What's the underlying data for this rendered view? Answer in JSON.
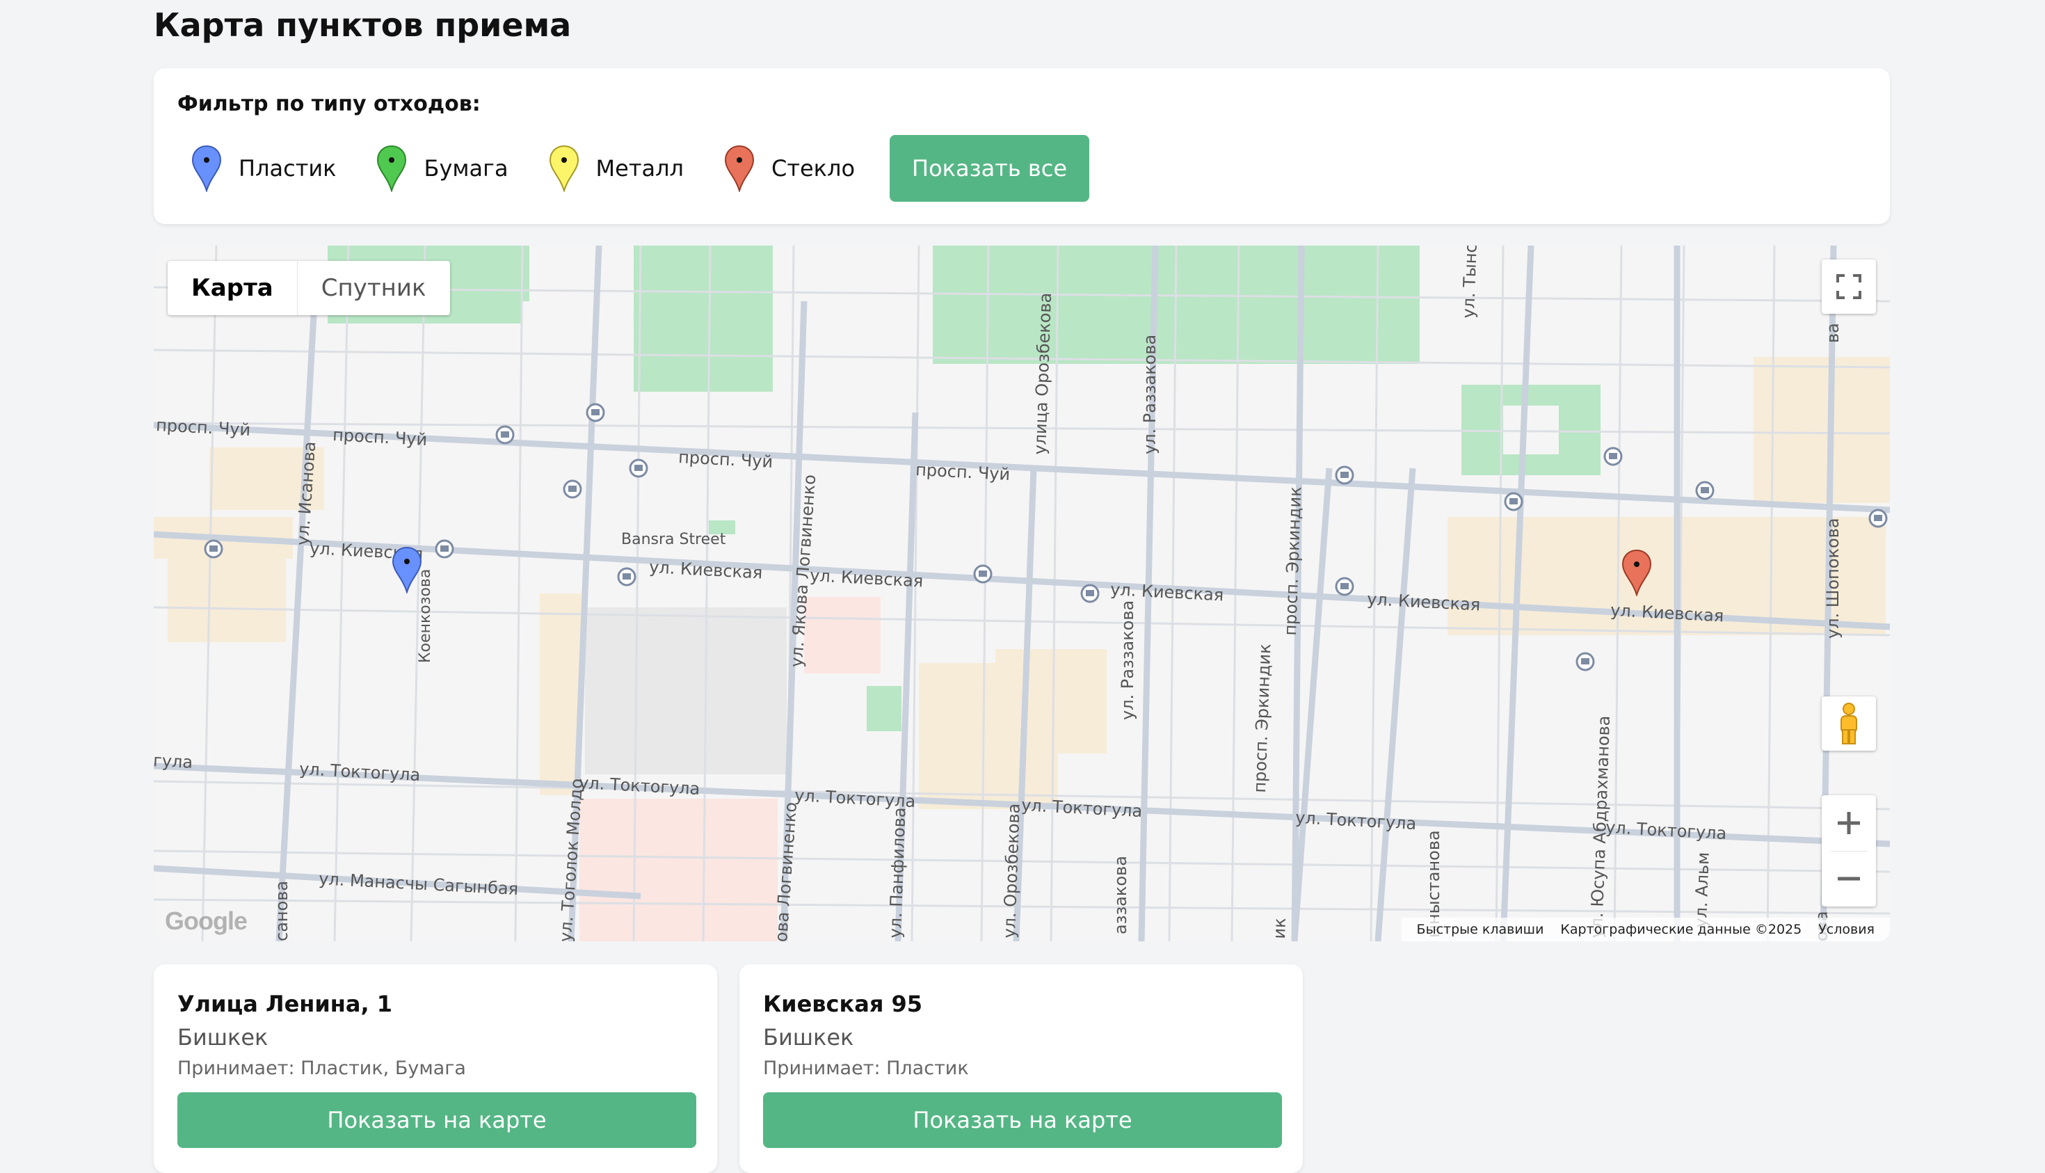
{
  "page": {
    "title": "Карта пунктов приема"
  },
  "filter": {
    "heading": "Фильтр по типу отходов:",
    "items": [
      {
        "label": "Пластик",
        "color": "#6991fd"
      },
      {
        "label": "Бумага",
        "color": "#4fc94f"
      },
      {
        "label": "Металл",
        "color": "#fdf569"
      },
      {
        "label": "Стекло",
        "color": "#e8735a"
      }
    ],
    "show_all_label": "Показать все",
    "accent_color": "#55b685"
  },
  "map": {
    "type_tabs": [
      "Карта",
      "Спутник"
    ],
    "active_tab": "Карта",
    "controls": [
      "fullscreen-icon",
      "pegman-icon",
      "zoom-in-icon",
      "zoom-out-icon"
    ],
    "logo": "Google",
    "attribution": {
      "shortcuts": "Быстрые клавиши",
      "data": "Картографические данные ©2025",
      "terms": "Условия"
    },
    "labels": {
      "chuy_1": "просп. Чуй",
      "chuy_2": "просп. Чуй",
      "chuy_3": "просп. Чуй",
      "chuy_4": "просп. Чуй",
      "kievskaya_1": "ул. Киевская",
      "kievskaya_2": "ул. Киевская",
      "kievskaya_3": "ул. Киевская",
      "kievskaya_4": "ул. Киевская",
      "kievskaya_5": "ул. Киевская",
      "kievskaya_6": "ул. Киевская",
      "toktogula_0": "гула",
      "toktogula_1": "ул. Токтогула",
      "toktogula_2": "ул. Токтогула",
      "toktogula_3": "ул. Токтогула",
      "toktogula_4": "ул. Токтогула",
      "toktogula_5": "ул. Токтогула",
      "toktogula_6": "ул. Токтогула",
      "manasa": "ул. Манасчы Сагынбая",
      "bansra": "Bansra Street",
      "isanova": "ул. Исанова",
      "isanova_2": "санова",
      "koenkozova": "Коенкозова",
      "togolok": "ул. Тоголок Молдо",
      "logvinenko_1": "ул. Якова Логвиненко",
      "logvinenko_2": "ова Логвиненко",
      "panfilova": "ул. Панфилова",
      "orozbekova_1": "улица Орозбекова",
      "orozbekova_2": "ул. Орозбекова",
      "razzakova_1": "ул. Раззакова",
      "razzakova_2": "ул. Раззакова",
      "razzakova_3": "аззакова",
      "erkindik_1": "просп. Эркиндик",
      "erkindik_2": "просп. Эркиндик",
      "erkindik_3": "ик",
      "tynys": "ул. Тынс",
      "isystanova": "ыныстанова",
      "abdrakhmanova": "ул. Юсупа Абдрахманова",
      "alm": "ул. Альм",
      "shopokova": "ул. Шопокова",
      "shopokova_2": "ова",
      "edge_right": "ва"
    }
  },
  "points": [
    {
      "title": "Улица Ленина, 1",
      "city": "Бишкек",
      "accepts": "Принимает: Пластик, Бумага",
      "button_label": "Показать на карте"
    },
    {
      "title": "Киевская 95",
      "city": "Бишкек",
      "accepts": "Принимает: Пластик",
      "button_label": "Показать на карте"
    }
  ]
}
